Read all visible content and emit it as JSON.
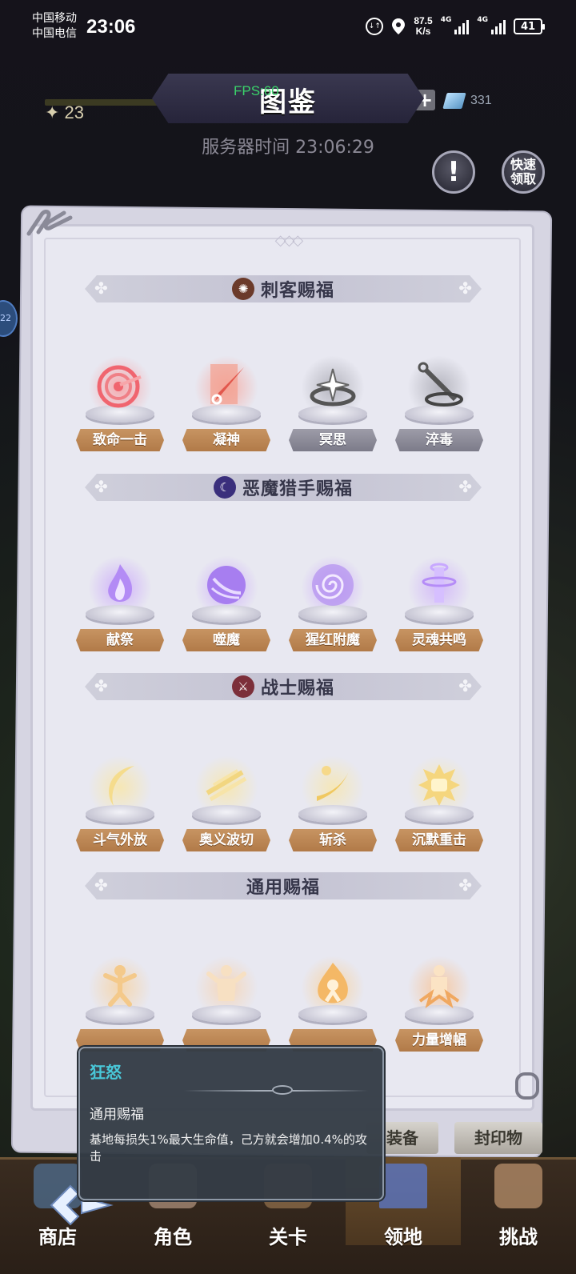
{
  "status_bar": {
    "carrier1": "中国移动",
    "carrier2": "中国电信",
    "time": "23:06",
    "speed_value": "87.5",
    "speed_unit": "K/s",
    "net1": "4G",
    "net2": "4G",
    "battery": "41"
  },
  "header": {
    "title": "图鉴",
    "fps_label": "FPS:60",
    "level": "23",
    "gem_count": "331",
    "server_time": "服务器时间 23:06:29",
    "info_button": "!",
    "quick_claim_line1": "快速",
    "quick_claim_line2": "领取",
    "side_badge": "22"
  },
  "sections": [
    {
      "title": "刺客赐福",
      "icon": "assassin-icon",
      "skills": [
        {
          "name": "致命一击",
          "icon": "target-icon",
          "locked": false
        },
        {
          "name": "凝神",
          "icon": "kunai-icon",
          "locked": false
        },
        {
          "name": "冥思",
          "icon": "shuriken-icon",
          "locked": true
        },
        {
          "name": "淬毒",
          "icon": "poison-blade-icon",
          "locked": true
        }
      ]
    },
    {
      "title": "恶魔猎手赐福",
      "icon": "demon-hunter-icon",
      "skills": [
        {
          "name": "献祭",
          "icon": "purple-flame-icon",
          "locked": false
        },
        {
          "name": "噬魔",
          "icon": "purple-orb-icon",
          "locked": false
        },
        {
          "name": "猩红附魔",
          "icon": "vortex-icon",
          "locked": false
        },
        {
          "name": "灵魂共鸣",
          "icon": "soul-totem-icon",
          "locked": false
        }
      ]
    },
    {
      "title": "战士赐福",
      "icon": "warrior-icon",
      "skills": [
        {
          "name": "斗气外放",
          "icon": "crescent-slash-icon",
          "locked": false
        },
        {
          "name": "奥义波切",
          "icon": "wave-slash-icon",
          "locked": false
        },
        {
          "name": "斩杀",
          "icon": "execute-icon",
          "locked": false
        },
        {
          "name": "沉默重击",
          "icon": "fist-icon",
          "locked": false
        }
      ]
    },
    {
      "title": "通用赐福",
      "icon": "",
      "skills": [
        {
          "name": "",
          "icon": "burst-figure-icon",
          "locked": false
        },
        {
          "name": "",
          "icon": "muscle-figure-icon",
          "locked": false
        },
        {
          "name": "",
          "icon": "fire-figure-icon",
          "locked": false
        },
        {
          "name": "力量增幅",
          "icon": "power-figure-icon",
          "locked": false
        }
      ]
    }
  ],
  "bottom_tabs": {
    "equip": "装备",
    "seal": "封印物"
  },
  "nav": [
    {
      "label": "商店",
      "icon": "shop-icon",
      "active": false
    },
    {
      "label": "角色",
      "icon": "character-icon",
      "active": false
    },
    {
      "label": "关卡",
      "icon": "stage-icon",
      "active": false
    },
    {
      "label": "领地",
      "icon": "castle-icon",
      "active": true
    },
    {
      "label": "挑战",
      "icon": "challenge-icon",
      "active": false
    }
  ],
  "tooltip": {
    "name": "狂怒",
    "category": "通用赐福",
    "description": "基地每损失1%最大生命值，己方就会增加0.4%的攻击"
  },
  "colors": {
    "label_unlocked": "#b17a48",
    "label_locked": "#7c7b89",
    "tooltip_name": "#49c8d9",
    "fps": "#3ad36a"
  }
}
